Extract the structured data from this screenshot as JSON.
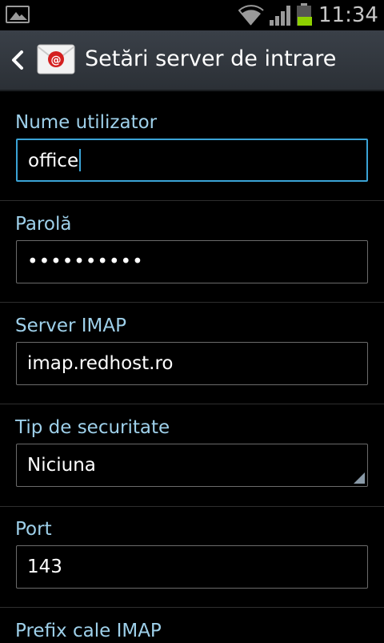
{
  "status_bar": {
    "time": "11:34",
    "battery_level": 0.45,
    "icons": [
      "image-notification-icon",
      "wifi-icon",
      "signal-icon",
      "battery-icon"
    ]
  },
  "action_bar": {
    "title": "Setări server de intrare",
    "app_icon": "email-app-icon",
    "back_icon": "back-chevron-icon"
  },
  "fields": {
    "username": {
      "label": "Nume utilizator",
      "value": "office"
    },
    "password": {
      "label": "Parolă",
      "value": "••••••••••"
    },
    "imap_server": {
      "label": "Server IMAP",
      "value": "imap.redhost.ro"
    },
    "security_type": {
      "label": "Tip de securitate",
      "value": "Niciuna"
    },
    "port": {
      "label": "Port",
      "value": "143"
    },
    "imap_prefix": {
      "label": "Prefix cale IMAP"
    }
  },
  "colors": {
    "label": "#9ed0ea",
    "focus": "#3aa3d6",
    "battery_fill": "#8ed000"
  }
}
